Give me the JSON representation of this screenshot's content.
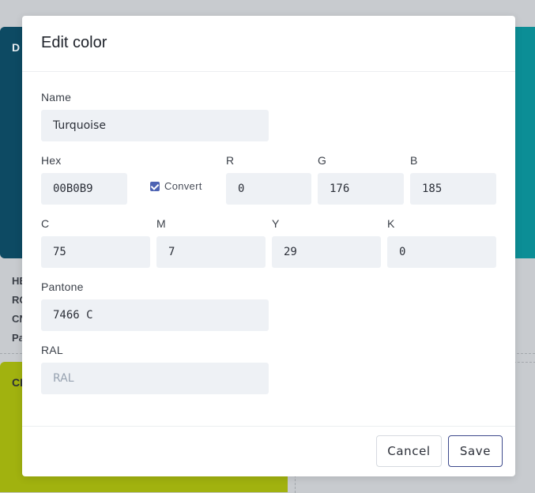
{
  "background": {
    "card_top_label": "D",
    "info_lines": [
      "HE",
      "RG",
      "CN",
      "Pa"
    ],
    "card_bottom_label": "CI"
  },
  "modal": {
    "title": "Edit color",
    "name": {
      "label": "Name",
      "value": "Turquoise"
    },
    "hex": {
      "label": "Hex",
      "value": "00B0B9"
    },
    "convert": {
      "label": "Convert",
      "checked": true
    },
    "rgb": {
      "r": {
        "label": "R",
        "value": "0"
      },
      "g": {
        "label": "G",
        "value": "176"
      },
      "b": {
        "label": "B",
        "value": "185"
      }
    },
    "cmyk": {
      "c": {
        "label": "C",
        "value": "75"
      },
      "m": {
        "label": "M",
        "value": "7"
      },
      "y": {
        "label": "Y",
        "value": "29"
      },
      "k": {
        "label": "K",
        "value": "0"
      }
    },
    "pantone": {
      "label": "Pantone",
      "value": "7466 C"
    },
    "ral": {
      "label": "RAL",
      "value": "",
      "placeholder": "RAL"
    },
    "buttons": {
      "cancel": "Cancel",
      "save": "Save"
    }
  },
  "colors": {
    "accent": "#3e4a8c",
    "checkbox": "#4d63b3",
    "card_dark": "#0d4a63",
    "card_teal": "#0c8e96",
    "card_lime": "#a1b20f"
  }
}
